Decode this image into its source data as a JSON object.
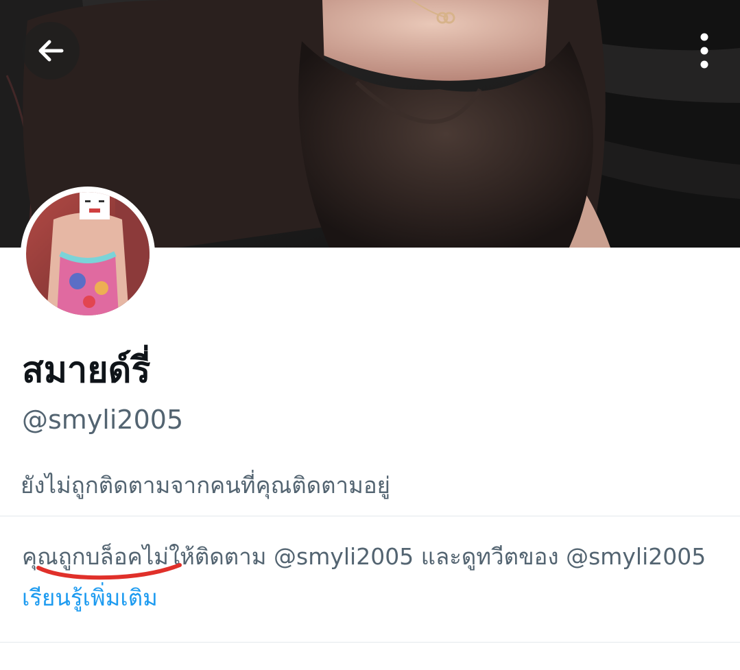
{
  "profile": {
    "display_name": "สมายด์รี่",
    "handle": "@smyli2005",
    "follow_note": "ยังไม่ถูกติดตามจากคนที่คุณติดตามอยู่"
  },
  "blocked_notice": {
    "prefix": "คุณถูกบล็อคไม่ให้ติดตาม",
    "handle_1": "@smyli2005",
    "middle": "และดูทวีตของ",
    "handle_2": "@smyli2005",
    "learn_more": "เรียนรู้เพิ่มเติม"
  },
  "icons": {
    "back": "arrow-left-icon",
    "more": "more-vertical-icon"
  },
  "colors": {
    "text_primary": "#0f1419",
    "text_secondary": "#536471",
    "link": "#1d9bf0",
    "annotation": "#e0302a"
  }
}
